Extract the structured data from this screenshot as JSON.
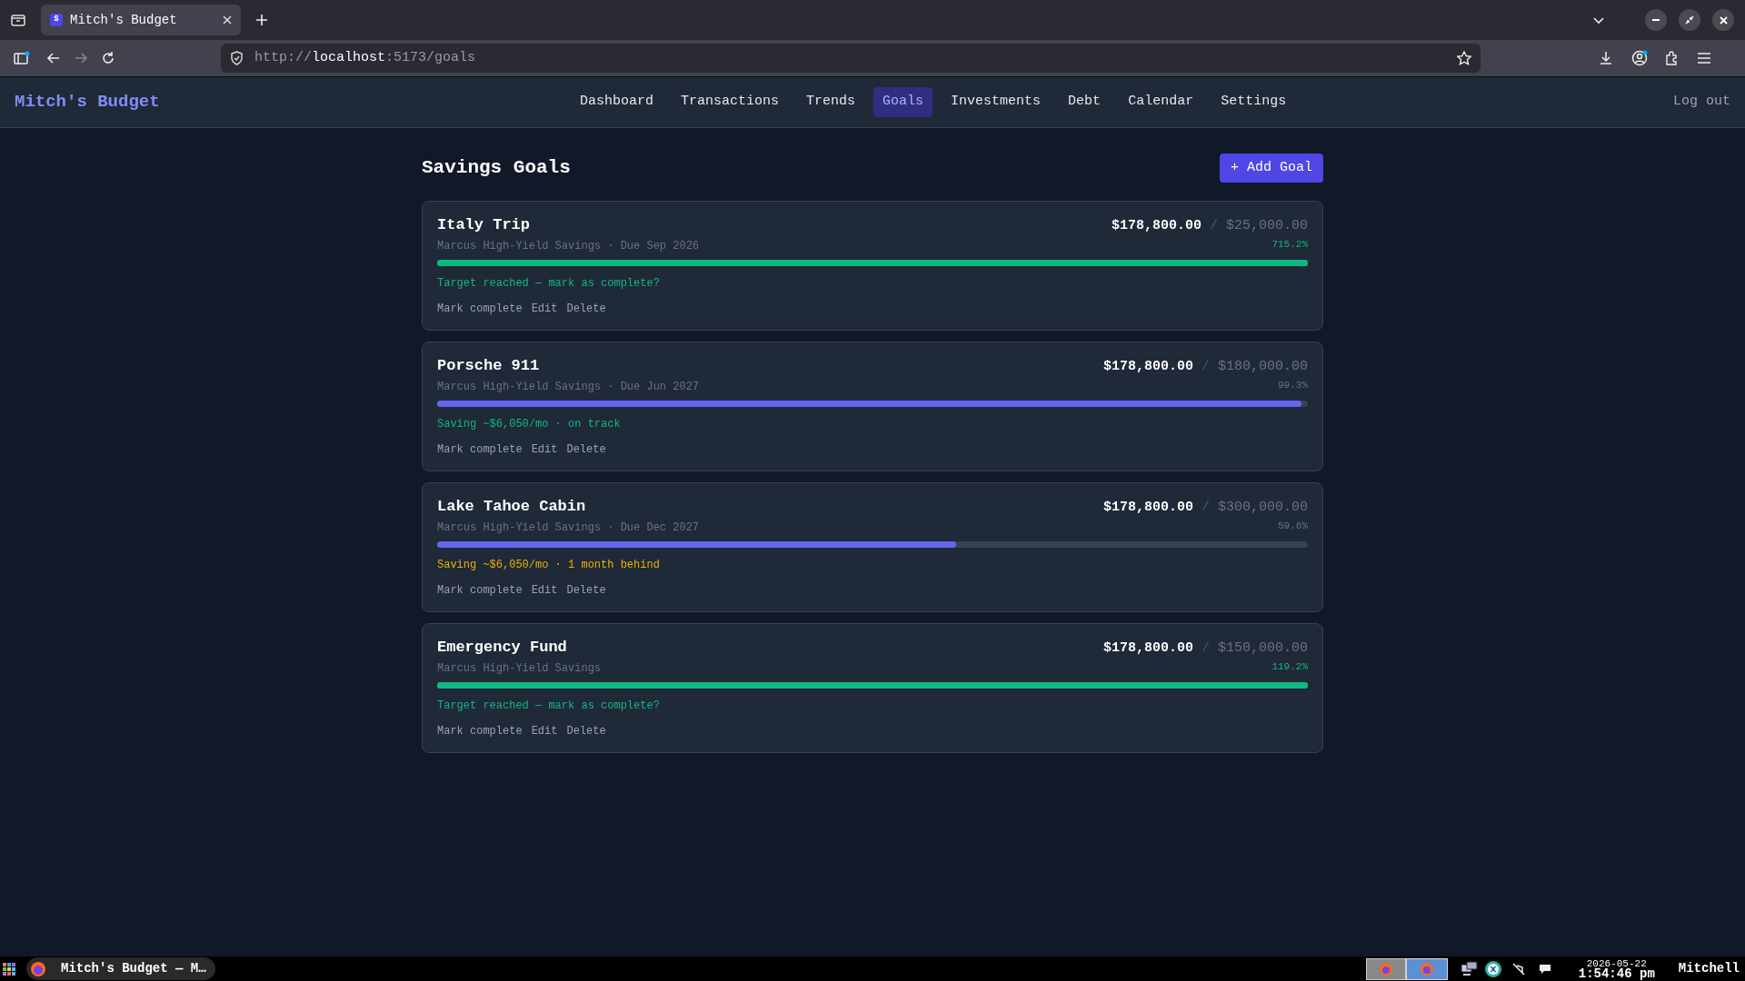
{
  "browser": {
    "tab_title": "Mitch's Budget",
    "tab_favicon": "$",
    "url_scheme": "http://",
    "url_host": "localhost",
    "url_rest": ":5173/goals"
  },
  "app": {
    "brand": "Mitch's Budget",
    "logout": "Log out",
    "nav": [
      {
        "label": "Dashboard",
        "selected": false
      },
      {
        "label": "Transactions",
        "selected": false
      },
      {
        "label": "Trends",
        "selected": false
      },
      {
        "label": "Goals",
        "selected": true
      },
      {
        "label": "Investments",
        "selected": false
      },
      {
        "label": "Debt",
        "selected": false
      },
      {
        "label": "Calendar",
        "selected": false
      },
      {
        "label": "Settings",
        "selected": false
      }
    ]
  },
  "page": {
    "title": "Savings Goals",
    "add_button": "+ Add Goal"
  },
  "goals": [
    {
      "name": "Italy Trip",
      "subtitle": "Marcus High-Yield Savings · Due Sep 2026",
      "saved": "$178,800.00",
      "separator": "/",
      "target": "$25,000.00",
      "percent": "715.2%",
      "level": 1,
      "kind": "reached",
      "message": "Target reached — mark as complete?",
      "actions": [
        "Mark complete",
        "Edit",
        "Delete"
      ]
    },
    {
      "name": "Porsche 911",
      "subtitle": "Marcus High-Yield Savings · Due Jun 2027",
      "saved": "$178,800.00",
      "separator": "/",
      "target": "$180,000.00",
      "percent": "99.3%",
      "level": 0.993,
      "kind": "on_track",
      "message": "Saving ~$6,050/mo · on track",
      "actions": [
        "Mark complete",
        "Edit",
        "Delete"
      ]
    },
    {
      "name": "Lake Tahoe Cabin",
      "subtitle": "Marcus High-Yield Savings · Due Dec 2027",
      "saved": "$178,800.00",
      "separator": "/",
      "target": "$300,000.00",
      "percent": "59.6%",
      "level": 0.596,
      "kind": "behind",
      "message": "Saving ~$6,050/mo · 1 month behind",
      "actions": [
        "Mark complete",
        "Edit",
        "Delete"
      ]
    },
    {
      "name": "Emergency Fund",
      "subtitle": "Marcus High-Yield Savings",
      "saved": "$178,800.00",
      "separator": "/",
      "target": "$150,000.00",
      "percent": "119.2%",
      "level": 1,
      "kind": "reached",
      "message": "Target reached — mark as complete?",
      "actions": [
        "Mark complete",
        "Edit",
        "Delete"
      ]
    }
  ],
  "taskbar": {
    "window_button": "Mitch's Budget — M…",
    "date": "2026-05-22",
    "time": "1:54:46 pm",
    "user": "Mitchell"
  }
}
